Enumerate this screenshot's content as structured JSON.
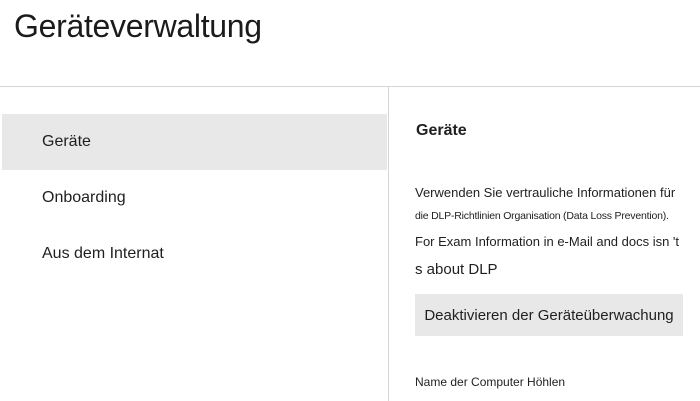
{
  "header": {
    "title": "Geräteverwaltung"
  },
  "sidebar": {
    "items": [
      {
        "label": "Geräte",
        "active": true
      },
      {
        "label": "Onboarding",
        "active": false
      },
      {
        "label": "Aus dem Internat",
        "active": false
      }
    ]
  },
  "detail": {
    "heading": "Geräte",
    "description_lines": [
      "Verwenden Sie vertrauliche Informationen für",
      "die DLP-Richtlinien Organisation (Data Loss Prevention).",
      "For Exam Information in e-Mail and docs isn 't",
      "s about DLP"
    ],
    "deactivate_button_label": "Deaktivieren der Geräteüberwachung",
    "computer_name_label": "Name der Computer Höhlen"
  },
  "colors": {
    "active_background": "#e8e8e8",
    "divider": "#d6d6d6",
    "text": "#1f1f1f"
  }
}
